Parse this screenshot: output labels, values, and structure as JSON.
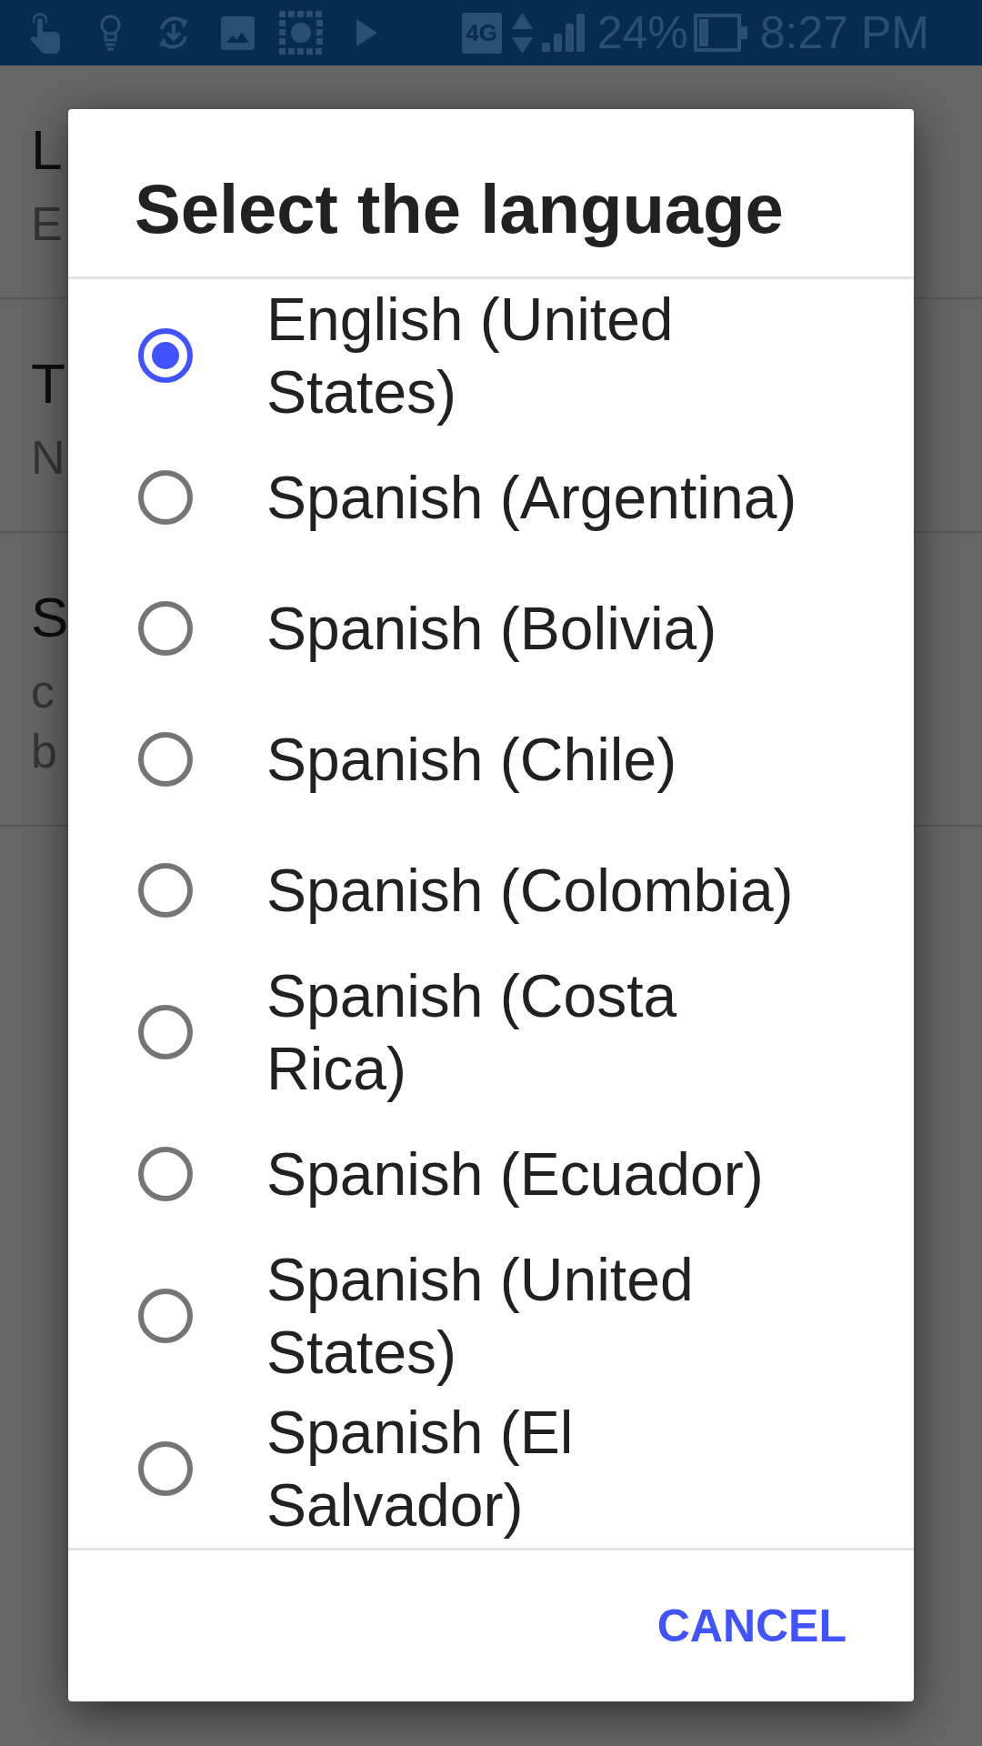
{
  "status_bar": {
    "network_type": "4G",
    "battery_percent": "24%",
    "time": "8:27 PM"
  },
  "settings": [
    {
      "title": "L",
      "summary": [
        "E"
      ]
    },
    {
      "title": "T",
      "summary": [
        "N"
      ]
    },
    {
      "title": "S",
      "summary": [
        "c",
        "b"
      ]
    }
  ],
  "dialog": {
    "title": "Select the language",
    "options": [
      {
        "label": "English (United States)",
        "selected": true
      },
      {
        "label": "Spanish (Argentina)",
        "selected": false
      },
      {
        "label": "Spanish (Bolivia)",
        "selected": false
      },
      {
        "label": "Spanish (Chile)",
        "selected": false
      },
      {
        "label": "Spanish (Colombia)",
        "selected": false
      },
      {
        "label": "Spanish (Costa Rica)",
        "selected": false
      },
      {
        "label": "Spanish (Ecuador)",
        "selected": false
      },
      {
        "label": "Spanish (United States)",
        "selected": false
      },
      {
        "label": "Spanish (El Salvador)",
        "selected": false
      }
    ],
    "buttons": [
      {
        "label": "CANCEL"
      }
    ]
  }
}
